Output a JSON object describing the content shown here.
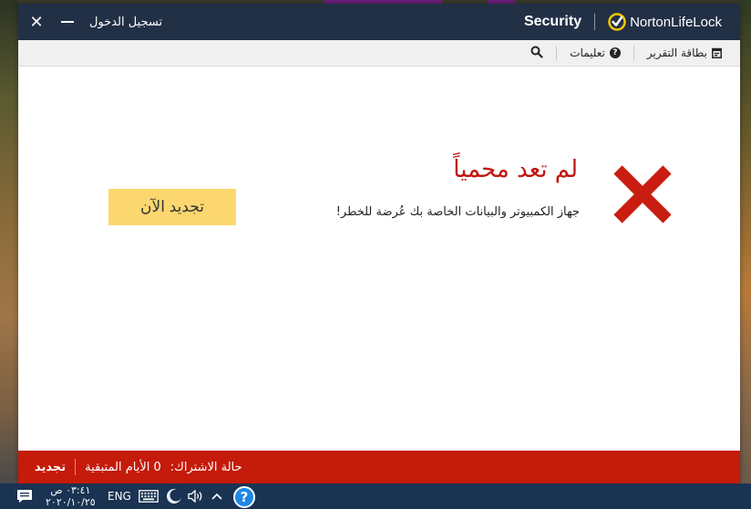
{
  "titlebar": {
    "product": "Security",
    "brand_name": "NortonLifeLock",
    "sign_in": "تسجيل الدخول",
    "close_glyph": "✕"
  },
  "toolbar": {
    "report_card": "بطاقة التقرير",
    "help": "تعليمات",
    "help_glyph": "?"
  },
  "status": {
    "headline": "لم تعد محمياً",
    "message": "جهاز الكمبيوتر والبيانات الخاصة بك عُرضة للخطر!",
    "renew_button": "تجديد الآن",
    "icon": "red-x-icon",
    "color": "#c0160f"
  },
  "footer": {
    "subscription_label": "حالة الاشتراك:",
    "days_remaining": "0 الأيام المتبقية",
    "renew_link": "تجديد",
    "color": "#c41b0a"
  },
  "taskbar": {
    "time": "٠٣:٤١ ص",
    "date": "٢٠٢٠/١٠/٢٥",
    "language": "ENG",
    "help_glyph": "?"
  },
  "colors": {
    "titlebar_bg": "#223046",
    "renew_button_bg": "#fcd770",
    "accent_red": "#c41b0a"
  }
}
